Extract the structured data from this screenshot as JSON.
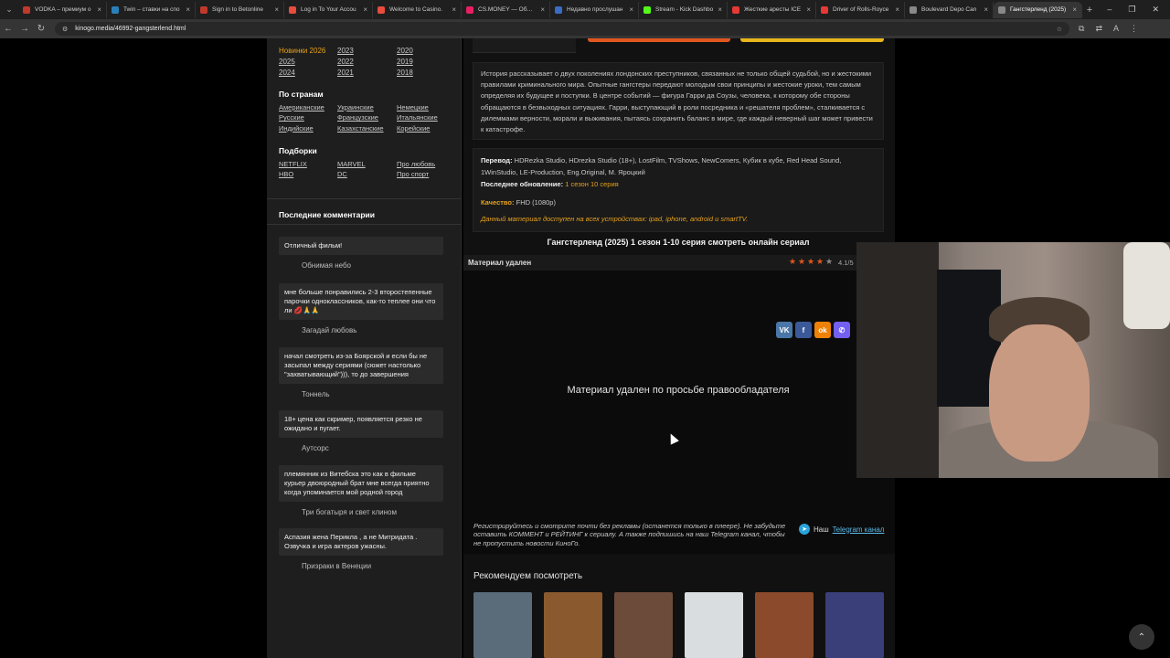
{
  "browser": {
    "tabs": [
      {
        "title": "VODKA – премиум о",
        "color": "#c0392b"
      },
      {
        "title": "Twin – ставки на спо",
        "color": "#2980b9"
      },
      {
        "title": "Sign in to Betonline",
        "color": "#c0392b"
      },
      {
        "title": "Log in To Your Accou",
        "color": "#e74c3c"
      },
      {
        "title": "Welcome to Casino.",
        "color": "#e74c3c"
      },
      {
        "title": "CS.MONEY — Обмен",
        "color": "#e91e63"
      },
      {
        "title": "Недавно прослушан",
        "color": "#3b6cc5"
      },
      {
        "title": "Stream - Kick Dashbo",
        "color": "#53fc18"
      },
      {
        "title": "Жесткие аресты ICE",
        "color": "#e53935"
      },
      {
        "title": "Driver of Rolls-Royce",
        "color": "#e53935"
      },
      {
        "title": "Boulevard Depo Can",
        "color": "#888888"
      },
      {
        "title": "Гангстерленд (2025)",
        "color": "#888888"
      }
    ],
    "url": "kinogo.media/46992-gangsterlend.html"
  },
  "sidebar": {
    "years": [
      "Новинки 2026",
      "2023",
      "2020",
      "2025",
      "2022",
      "2019",
      "2024",
      "2021",
      "2018"
    ],
    "countries_title": "По странам",
    "countries": [
      "Американские",
      "Украинские",
      "Немецкие",
      "Русские",
      "Французские",
      "Итальянские",
      "Индийские",
      "Казахстанские",
      "Корейские"
    ],
    "collections_title": "Подборки",
    "collections": [
      "NETFLIX",
      "MARVEL",
      "Про любовь",
      "HBO",
      "DC",
      "Про спорт"
    ],
    "comments_title": "Последние комментарии",
    "comments": [
      {
        "text": "Отличный фильм!",
        "source": "Обнимая небо"
      },
      {
        "text": "мне больше понравились 2-3 второстепенные парочки одноклассников, как-то теплее они что ли 💋🙏🙏",
        "source": "Загадай любовь"
      },
      {
        "text": "начал смотреть из-за Боярской и если бы не засыпал между сериями (сюжет настолько \"захватывающий\"))), то до завершения",
        "source": "Тоннель"
      },
      {
        "text": "18+ цена как скример, появляется резко не ожидано и пугает.",
        "source": "Аутсорс"
      },
      {
        "text": "племянник из Витебска это как в фильме курьер двоюродный брат мне всегда приятно когда упоминается мой родной город",
        "source": "Три богатыря и свет клином"
      },
      {
        "text": "Аспазия жена Перикла , а не Митридата . Озвучка и игра актеров ужасны.",
        "source": "Призраки в Венеции"
      }
    ]
  },
  "main": {
    "description": "История рассказывает о двух поколениях лондонских преступников, связанных не только общей судьбой, но и жестокими правилами криминального мира. Опытные гангстеры передают молодым свои принципы и жестокие уроки, тем самым определяя их будущее и поступки. В центре событий — фигура Гарри да Соузы, человека, к которому обе стороны обращаются в безвыходных ситуациях. Гарри, выступающий в роли посредника и «решателя проблем», сталкивается с дилеммами верности, морали и выживания, пытаясь сохранить баланс в мире, где каждый неверный шаг может привести к катастрофе.",
    "translation_label": "Перевод:",
    "translation_value": "HDRezka Studio, HDrezka Studio (18+), LostFilm, TVShows, NewComers, Кубик в кубе, Red Head Sound, 1WinStudio, LE-Production, Eng.Original, М. Яроцкий",
    "update_label": "Последнее обновление:",
    "update_value": "1 сезон 10 серия",
    "quality_label": "Качество:",
    "quality_value": "FHD (1080p)",
    "devices_note": "Данный материал доступен на всех устройствах: ipad, iphone, android и smartTV.",
    "video_title": "Гангстерленд (2025) 1 сезон 1-10 серия смотреть онлайн сериал",
    "player_tab": "Материал удален",
    "rating_value": 4.1,
    "rating_text": "4.1/5",
    "removed_message": "Материал удален по просьбе правообладателя",
    "share_icons": [
      {
        "label": "VK",
        "color": "#4a76a8"
      },
      {
        "label": "f",
        "color": "#3b5998"
      },
      {
        "label": "ok",
        "color": "#ee8208"
      },
      {
        "label": "✆",
        "color": "#7360f2"
      }
    ],
    "promo_text": "Регистрируйтесь и смотрите почти без рекламы (останется только в плеере). Не забудьте оставить КОММЕНТ и РЕЙТИНГ к сериалу. А также подпишись на наш Telegram канал, чтобы не пропустить новости КиноГо.",
    "telegram_prefix": "Наш",
    "telegram_link": "Telegram канал",
    "recommend_title": "Рекомендуем посмотреть",
    "recommend_posters": [
      "#5a6b7a",
      "#8a5a2e",
      "#6d4b3a",
      "#d9dde0",
      "#8b4a2b",
      "#3a3f7a"
    ]
  }
}
